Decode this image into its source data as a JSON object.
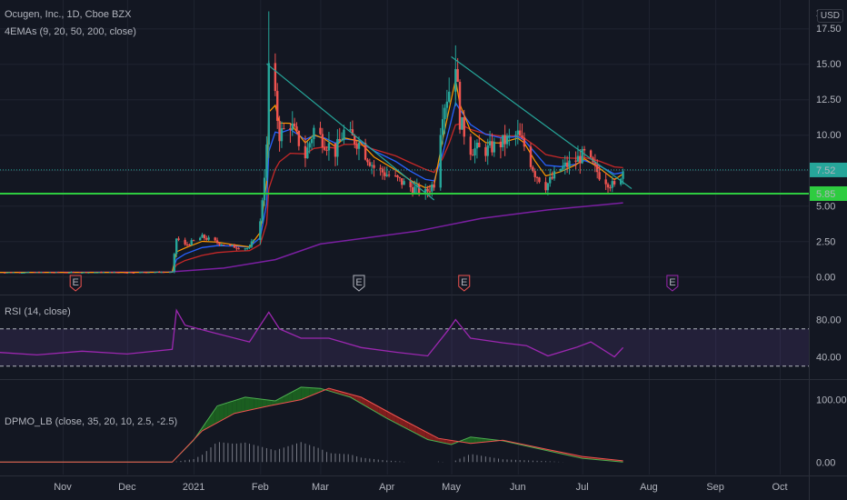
{
  "header": {
    "symbol": "Ocugen, Inc., 1D, Cboe BZX",
    "indicator": "4EMAs (9, 20, 50, 200, close)",
    "currency": "USD",
    "rsi_label": "RSI (14, close)",
    "dpmo_label": "DPMO_LB (close, 35, 20, 10, 2.5, -2.5)"
  },
  "colors": {
    "background": "#131722",
    "grid": "#1f2330",
    "up": "#26a69a",
    "down": "#ef5350",
    "support_line": "#2ecc40",
    "trendline": "#26a69a",
    "ema9": "#ff9800",
    "ema20": "#2962ff",
    "ema50": "#c62828",
    "ema200": "#7b1fa2",
    "rsi": "#9c27b0"
  },
  "chart_data": [
    {
      "type": "line",
      "name": "price",
      "title": "Ocugen, Inc., 1D, Cboe BZX",
      "x_ticks": [
        "Nov",
        "Dec",
        "2021",
        "Feb",
        "Mar",
        "Apr",
        "May",
        "Jun",
        "Jul",
        "Aug",
        "Sep",
        "Oct"
      ],
      "y_ticks": [
        "0.00",
        "2.50",
        "5.00",
        "7.50",
        "10.00",
        "12.50",
        "15.00",
        "17.50"
      ],
      "ylim": [
        -1.2,
        19.5
      ],
      "price_labels": [
        {
          "text": "7.52",
          "value": 7.52
        },
        {
          "text": "5.85",
          "value": 5.85
        }
      ],
      "horizontal_line": 5.85,
      "current_price_line": 7.52,
      "trendlines": [
        {
          "from": {
            "date": "2021-02-04",
            "value": 15.0
          },
          "to": {
            "date": "2021-04-23",
            "value": 5.4
          }
        },
        {
          "from": {
            "date": "2021-05-01",
            "value": 15.5
          },
          "to": {
            "date": "2021-07-24",
            "value": 6.2
          }
        }
      ],
      "earnings_markers": [
        {
          "date": "2020-11-07",
          "label": "E"
        },
        {
          "date": "2021-03-19",
          "label": "E"
        },
        {
          "date": "2021-05-07",
          "label": "E"
        },
        {
          "date": "2021-08-12",
          "label": "E"
        }
      ],
      "close_series": [
        [
          "2020-10-01",
          0.3
        ],
        [
          "2020-11-01",
          0.3
        ],
        [
          "2020-12-01",
          0.3
        ],
        [
          "2020-12-22",
          0.33
        ],
        [
          "2020-12-24",
          2.7
        ],
        [
          "2020-12-28",
          2.2
        ],
        [
          "2021-01-05",
          2.8
        ],
        [
          "2021-01-12",
          2.4
        ],
        [
          "2021-01-20",
          2.1
        ],
        [
          "2021-01-27",
          2.0
        ],
        [
          "2021-02-01",
          3.8
        ],
        [
          "2021-02-04",
          9.0
        ],
        [
          "2021-02-05",
          14.9
        ],
        [
          "2021-02-08",
          12.4
        ],
        [
          "2021-02-10",
          10.0
        ],
        [
          "2021-02-15",
          10.8
        ],
        [
          "2021-02-22",
          8.5
        ],
        [
          "2021-02-26",
          10.4
        ],
        [
          "2021-03-03",
          9.5
        ],
        [
          "2021-03-08",
          8.8
        ],
        [
          "2021-03-12",
          10.2
        ],
        [
          "2021-03-19",
          9.4
        ],
        [
          "2021-03-26",
          7.7
        ],
        [
          "2021-04-05",
          6.9
        ],
        [
          "2021-04-12",
          6.3
        ],
        [
          "2021-04-19",
          5.9
        ],
        [
          "2021-04-23",
          6.6
        ],
        [
          "2021-04-27",
          11.8
        ],
        [
          "2021-04-30",
          13.2
        ],
        [
          "2021-05-03",
          15.3
        ],
        [
          "2021-05-05",
          11.0
        ],
        [
          "2021-05-10",
          9.0
        ],
        [
          "2021-05-17",
          8.9
        ],
        [
          "2021-05-24",
          9.4
        ],
        [
          "2021-06-01",
          10.0
        ],
        [
          "2021-06-04",
          9.2
        ],
        [
          "2021-06-09",
          7.3
        ],
        [
          "2021-06-14",
          6.4
        ],
        [
          "2021-06-21",
          7.6
        ],
        [
          "2021-06-28",
          8.2
        ],
        [
          "2021-07-02",
          8.6
        ],
        [
          "2021-07-09",
          7.2
        ],
        [
          "2021-07-16",
          6.3
        ],
        [
          "2021-07-20",
          7.52
        ]
      ],
      "ema200_series": [
        [
          "2020-10-01",
          0.3
        ],
        [
          "2020-12-20",
          0.32
        ],
        [
          "2021-01-15",
          0.6
        ],
        [
          "2021-02-08",
          1.2
        ],
        [
          "2021-03-01",
          2.3
        ],
        [
          "2021-04-15",
          3.2
        ],
        [
          "2021-05-15",
          4.1
        ],
        [
          "2021-06-15",
          4.7
        ],
        [
          "2021-07-20",
          5.2
        ]
      ]
    },
    {
      "type": "line",
      "name": "rsi",
      "title": "RSI (14, close)",
      "y_ticks": [
        "40.00",
        "80.00"
      ],
      "ylim": [
        17,
        105
      ],
      "bands": [
        70,
        30
      ],
      "series": [
        [
          "2020-10-01",
          45
        ],
        [
          "2020-10-20",
          42
        ],
        [
          "2020-11-10",
          46
        ],
        [
          "2020-12-01",
          43
        ],
        [
          "2020-12-22",
          48
        ],
        [
          "2020-12-24",
          90
        ],
        [
          "2020-12-28",
          74
        ],
        [
          "2021-01-10",
          66
        ],
        [
          "2021-01-27",
          56
        ],
        [
          "2021-02-05",
          88
        ],
        [
          "2021-02-10",
          70
        ],
        [
          "2021-02-20",
          60
        ],
        [
          "2021-03-05",
          60
        ],
        [
          "2021-03-20",
          50
        ],
        [
          "2021-04-05",
          45
        ],
        [
          "2021-04-20",
          41
        ],
        [
          "2021-04-30",
          70
        ],
        [
          "2021-05-03",
          80
        ],
        [
          "2021-05-10",
          60
        ],
        [
          "2021-05-25",
          55
        ],
        [
          "2021-06-05",
          52
        ],
        [
          "2021-06-15",
          41
        ],
        [
          "2021-06-28",
          50
        ],
        [
          "2021-07-05",
          56
        ],
        [
          "2021-07-16",
          40
        ],
        [
          "2021-07-20",
          50
        ]
      ]
    },
    {
      "type": "area",
      "name": "dpmo",
      "title": "DPMO_LB (close, 35, 20, 10, 2.5, -2.5)",
      "y_ticks": [
        "0.00",
        "100.00"
      ],
      "ylim": [
        -20,
        130
      ],
      "series": [
        {
          "name": "DPMO",
          "values": [
            [
              "2020-10-01",
              0
            ],
            [
              "2020-12-22",
              0
            ],
            [
              "2021-01-01",
              35
            ],
            [
              "2021-01-12",
              90
            ],
            [
              "2021-01-25",
              104
            ],
            [
              "2021-02-08",
              98
            ],
            [
              "2021-02-20",
              120
            ],
            [
              "2021-03-01",
              118
            ],
            [
              "2021-03-15",
              104
            ],
            [
              "2021-04-01",
              70
            ],
            [
              "2021-04-20",
              36
            ],
            [
              "2021-05-01",
              28
            ],
            [
              "2021-05-10",
              40
            ],
            [
              "2021-05-25",
              34
            ],
            [
              "2021-06-15",
              18
            ],
            [
              "2021-07-01",
              6
            ],
            [
              "2021-07-20",
              0
            ]
          ]
        },
        {
          "name": "Signal",
          "values": [
            [
              "2020-10-01",
              0
            ],
            [
              "2020-12-22",
              0
            ],
            [
              "2021-01-05",
              50
            ],
            [
              "2021-01-20",
              78
            ],
            [
              "2021-02-05",
              90
            ],
            [
              "2021-02-20",
              100
            ],
            [
              "2021-03-05",
              118
            ],
            [
              "2021-03-20",
              104
            ],
            [
              "2021-04-05",
              74
            ],
            [
              "2021-04-25",
              38
            ],
            [
              "2021-05-10",
              30
            ],
            [
              "2021-05-25",
              35
            ],
            [
              "2021-06-15",
              20
            ],
            [
              "2021-07-01",
              9
            ],
            [
              "2021-07-20",
              2
            ]
          ]
        }
      ]
    }
  ]
}
